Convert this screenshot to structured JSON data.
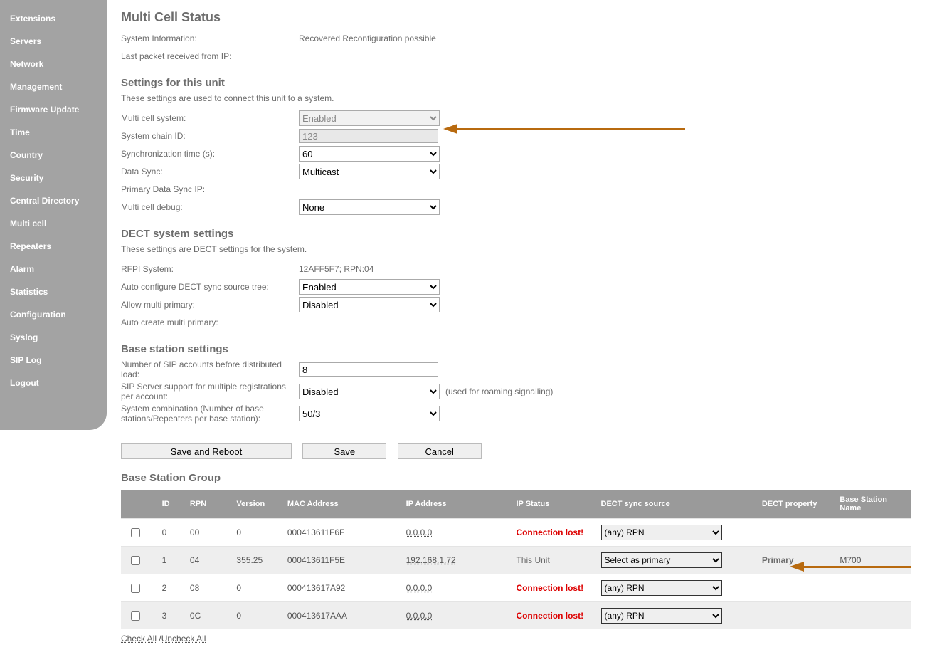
{
  "sidebar": {
    "items": [
      {
        "label": "Extensions"
      },
      {
        "label": "Servers"
      },
      {
        "label": "Network"
      },
      {
        "label": "Management"
      },
      {
        "label": "Firmware Update"
      },
      {
        "label": "Time"
      },
      {
        "label": "Country"
      },
      {
        "label": "Security"
      },
      {
        "label": "Central Directory"
      },
      {
        "label": "Multi cell"
      },
      {
        "label": "Repeaters"
      },
      {
        "label": "Alarm"
      },
      {
        "label": "Statistics"
      },
      {
        "label": "Configuration"
      },
      {
        "label": "Syslog"
      },
      {
        "label": "SIP Log"
      },
      {
        "label": "Logout"
      }
    ]
  },
  "page": {
    "title": "Multi Cell Status",
    "sysinfo_label": "System Information:",
    "sysinfo_value": "Recovered Reconfiguration possible",
    "lastpkt_label": "Last packet received from IP:",
    "lastpkt_value": ""
  },
  "settings": {
    "title": "Settings for this unit",
    "desc": "These settings are used to connect this unit to a system.",
    "mcs_label": "Multi cell system:",
    "mcs_value": "Enabled",
    "chain_label": "System chain ID:",
    "chain_value": "123",
    "sync_label": "Synchronization time (s):",
    "sync_value": "60",
    "datasync_label": "Data Sync:",
    "datasync_value": "Multicast",
    "primip_label": "Primary Data Sync IP:",
    "primip_value": "",
    "debug_label": "Multi cell debug:",
    "debug_value": "None"
  },
  "dect": {
    "title": "DECT system settings",
    "desc": "These settings are DECT settings for the system.",
    "rfpi_label": "RFPI System:",
    "rfpi_value": "12AFF5F7; RPN:04",
    "auto_label": "Auto configure DECT sync source tree:",
    "auto_value": "Enabled",
    "allow_label": "Allow multi primary:",
    "allow_value": "Disabled",
    "autocreate_label": "Auto create multi primary:",
    "autocreate_value": ""
  },
  "base": {
    "title": "Base station settings",
    "sip_label": "Number of SIP accounts before distributed load:",
    "sip_value": "8",
    "multi_label": "SIP Server support for multiple registrations per account:",
    "multi_value": "Disabled",
    "multi_note": "(used for roaming signalling)",
    "combo_label": "System combination (Number of base stations/Repeaters per base station):",
    "combo_value": "50/3"
  },
  "buttons": {
    "save_reboot": "Save and Reboot",
    "save": "Save",
    "cancel": "Cancel"
  },
  "group": {
    "title": "Base Station Group",
    "headers": {
      "blank": "",
      "id": "ID",
      "rpn": "RPN",
      "ver": "Version",
      "mac": "MAC Address",
      "ip": "IP Address",
      "ipstatus": "IP Status",
      "sync": "DECT sync source",
      "prop": "DECT property",
      "name": "Base Station Name"
    },
    "rows": [
      {
        "id": "0",
        "rpn": "00",
        "ver": "0",
        "mac": "000413611F6F",
        "ip": "0.0.0.0",
        "status": "Connection lost!",
        "status_class": "lost",
        "sync": "(any) RPN",
        "prop": "",
        "name": ""
      },
      {
        "id": "1",
        "rpn": "04",
        "ver": "355.25",
        "mac": "000413611F5E",
        "ip": "192.168.1.72",
        "status": "This Unit",
        "status_class": "unit",
        "sync": "Select as primary",
        "prop": "Primary",
        "name": "M700",
        "shade": true
      },
      {
        "id": "2",
        "rpn": "08",
        "ver": "0",
        "mac": "000413617A92",
        "ip": "0.0.0.0",
        "status": "Connection lost!",
        "status_class": "lost",
        "sync": "(any) RPN",
        "prop": "",
        "name": ""
      },
      {
        "id": "3",
        "rpn": "0C",
        "ver": "0",
        "mac": "000413617AAA",
        "ip": "0.0.0.0",
        "status": "Connection lost!",
        "status_class": "lost",
        "sync": "(any) RPN",
        "prop": "",
        "name": "",
        "shade": true
      }
    ],
    "check_all": "Check All",
    "uncheck_all": "Uncheck All",
    "sep": " /"
  }
}
